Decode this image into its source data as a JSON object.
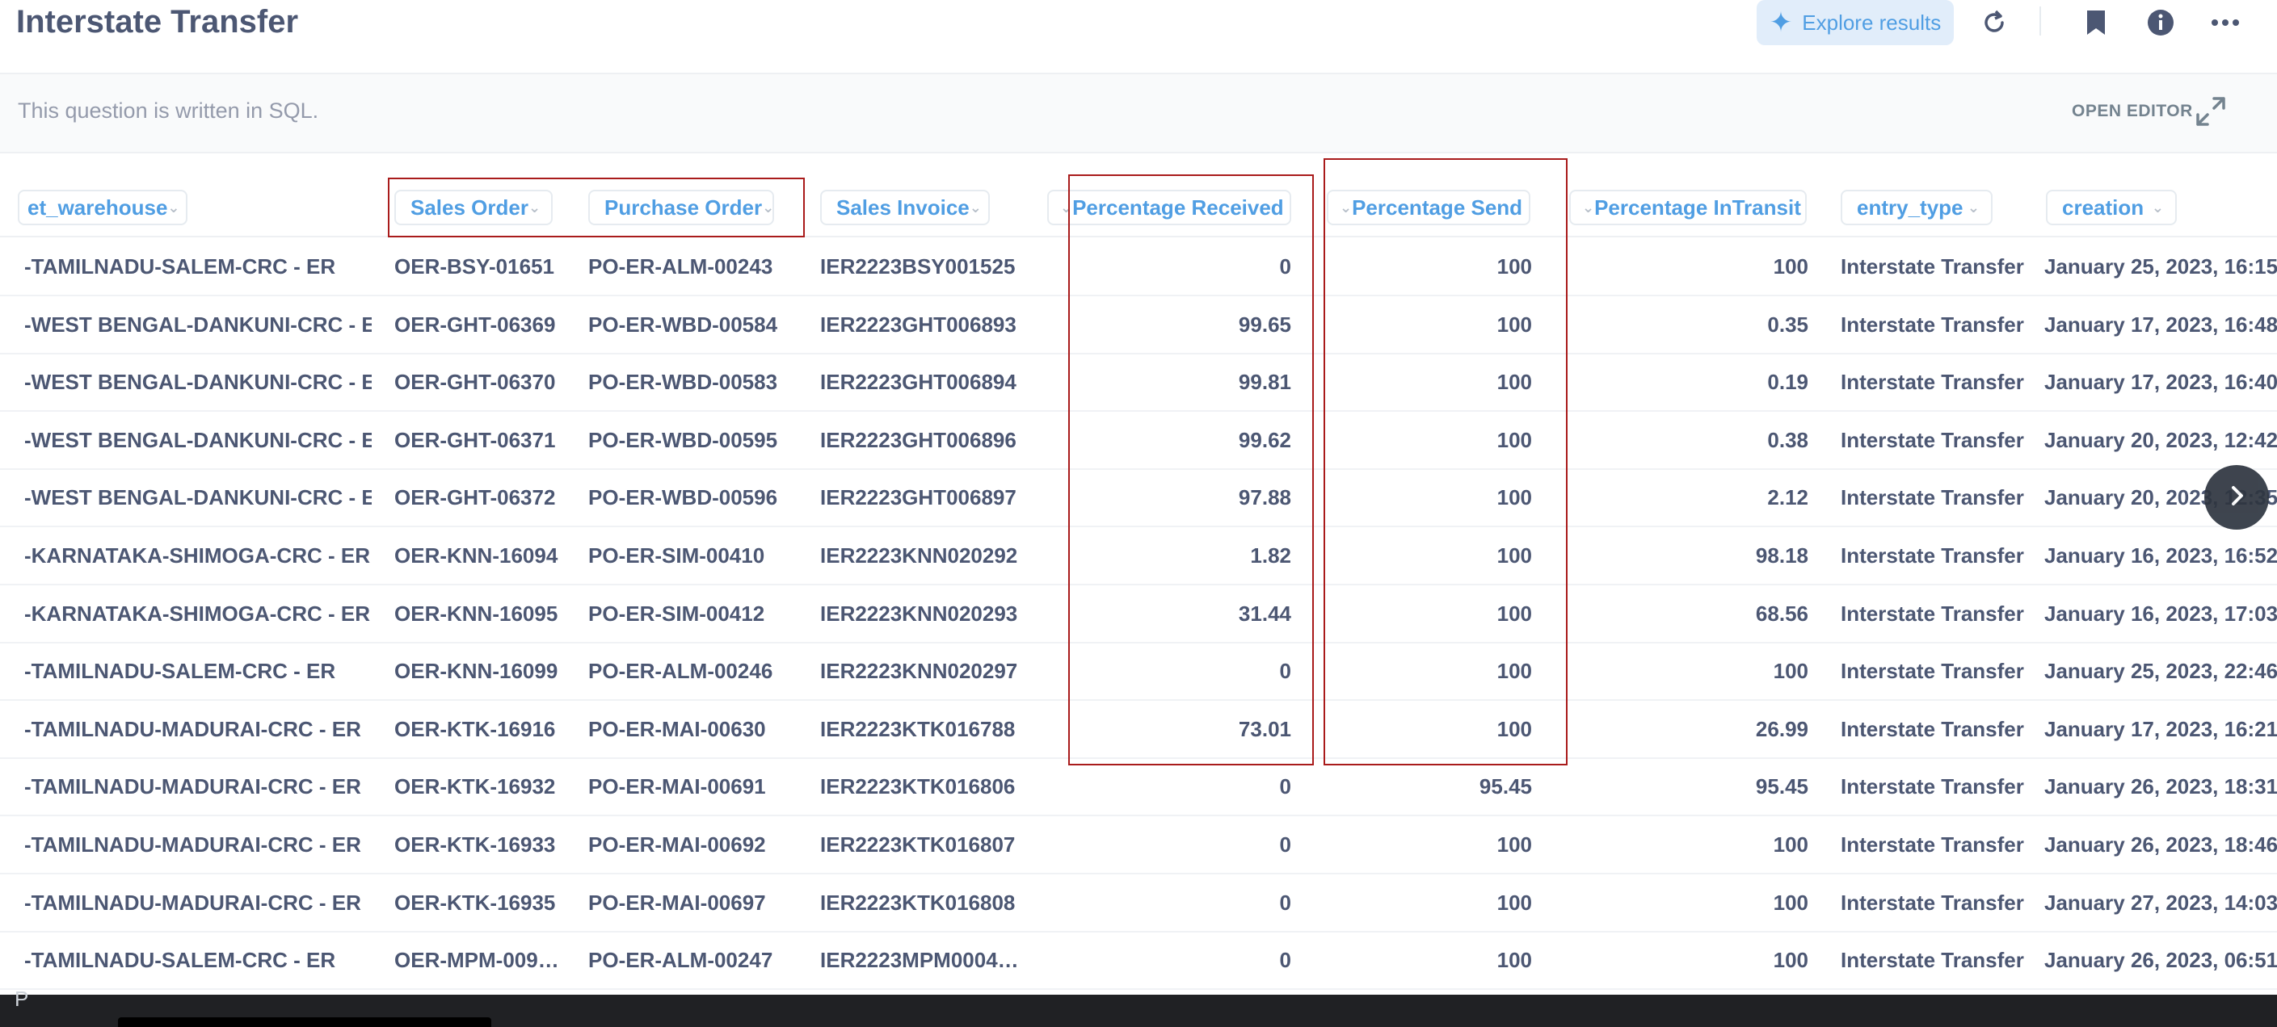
{
  "header": {
    "title": "Interstate Transfer",
    "explore_label": "Explore results",
    "sql_note": "This question is written in SQL.",
    "open_editor_label": "OPEN EDITOR"
  },
  "columns": [
    "et_warehouse",
    "Sales Order",
    "Purchase Order",
    "Sales Invoice",
    "Percentage Received",
    "Percentage Send",
    "Percentage InTransit",
    "entry_type",
    "creation"
  ],
  "rows": [
    [
      "-TAMILNADU-SALEM-CRC - ER",
      "OER-BSY-01651",
      "PO-ER-ALM-00243",
      "IER2223BSY001525",
      "0",
      "100",
      "100",
      "Interstate Transfer",
      "January 25, 2023, 16:15"
    ],
    [
      "-WEST BENGAL-DANKUNI-CRC - ER",
      "OER-GHT-06369",
      "PO-ER-WBD-00584",
      "IER2223GHT006893",
      "99.65",
      "100",
      "0.35",
      "Interstate Transfer",
      "January 17, 2023, 16:48"
    ],
    [
      "-WEST BENGAL-DANKUNI-CRC - ER",
      "OER-GHT-06370",
      "PO-ER-WBD-00583",
      "IER2223GHT006894",
      "99.81",
      "100",
      "0.19",
      "Interstate Transfer",
      "January 17, 2023, 16:40"
    ],
    [
      "-WEST BENGAL-DANKUNI-CRC - ER",
      "OER-GHT-06371",
      "PO-ER-WBD-00595",
      "IER2223GHT006896",
      "99.62",
      "100",
      "0.38",
      "Interstate Transfer",
      "January 20, 2023, 12:42"
    ],
    [
      "-WEST BENGAL-DANKUNI-CRC - ER",
      "OER-GHT-06372",
      "PO-ER-WBD-00596",
      "IER2223GHT006897",
      "97.88",
      "100",
      "2.12",
      "Interstate Transfer",
      "January 20, 2023, 12:35"
    ],
    [
      "-KARNATAKA-SHIMOGA-CRC - ER",
      "OER-KNN-16094",
      "PO-ER-SIM-00410",
      "IER2223KNN020292",
      "1.82",
      "100",
      "98.18",
      "Interstate Transfer",
      "January 16, 2023, 16:52"
    ],
    [
      "-KARNATAKA-SHIMOGA-CRC - ER",
      "OER-KNN-16095",
      "PO-ER-SIM-00412",
      "IER2223KNN020293",
      "31.44",
      "100",
      "68.56",
      "Interstate Transfer",
      "January 16, 2023, 17:03"
    ],
    [
      "-TAMILNADU-SALEM-CRC - ER",
      "OER-KNN-16099",
      "PO-ER-ALM-00246",
      "IER2223KNN020297",
      "0",
      "100",
      "100",
      "Interstate Transfer",
      "January 25, 2023, 22:46"
    ],
    [
      "-TAMILNADU-MADURAI-CRC - ER",
      "OER-KTK-16916",
      "PO-ER-MAI-00630",
      "IER2223KTK016788",
      "73.01",
      "100",
      "26.99",
      "Interstate Transfer",
      "January 17, 2023, 16:21"
    ],
    [
      "-TAMILNADU-MADURAI-CRC - ER",
      "OER-KTK-16932",
      "PO-ER-MAI-00691",
      "IER2223KTK016806",
      "0",
      "95.45",
      "95.45",
      "Interstate Transfer",
      "January 26, 2023, 18:31"
    ],
    [
      "-TAMILNADU-MADURAI-CRC - ER",
      "OER-KTK-16933",
      "PO-ER-MAI-00692",
      "IER2223KTK016807",
      "0",
      "100",
      "100",
      "Interstate Transfer",
      "January 26, 2023, 18:46"
    ],
    [
      "-TAMILNADU-MADURAI-CRC - ER",
      "OER-KTK-16935",
      "PO-ER-MAI-00697",
      "IER2223KTK016808",
      "0",
      "100",
      "100",
      "Interstate Transfer",
      "January 27, 2023, 14:03"
    ],
    [
      "-TAMILNADU-SALEM-CRC - ER",
      "OER-MPM-009…",
      "PO-ER-ALM-00247",
      "IER2223MPM0004…",
      "0",
      "100",
      "100",
      "Interstate Transfer",
      "January 26, 2023, 06:51"
    ]
  ],
  "footer": {
    "char": "P"
  },
  "colors": {
    "accent": "#509ee3",
    "highlight_box": "#a91b1b",
    "text": "#4c5773"
  },
  "icons": [
    "plus-icon",
    "refresh-icon",
    "bookmark-icon",
    "info-icon",
    "more-icon",
    "expand-icon",
    "chevron-down-icon",
    "chevron-right-icon"
  ]
}
